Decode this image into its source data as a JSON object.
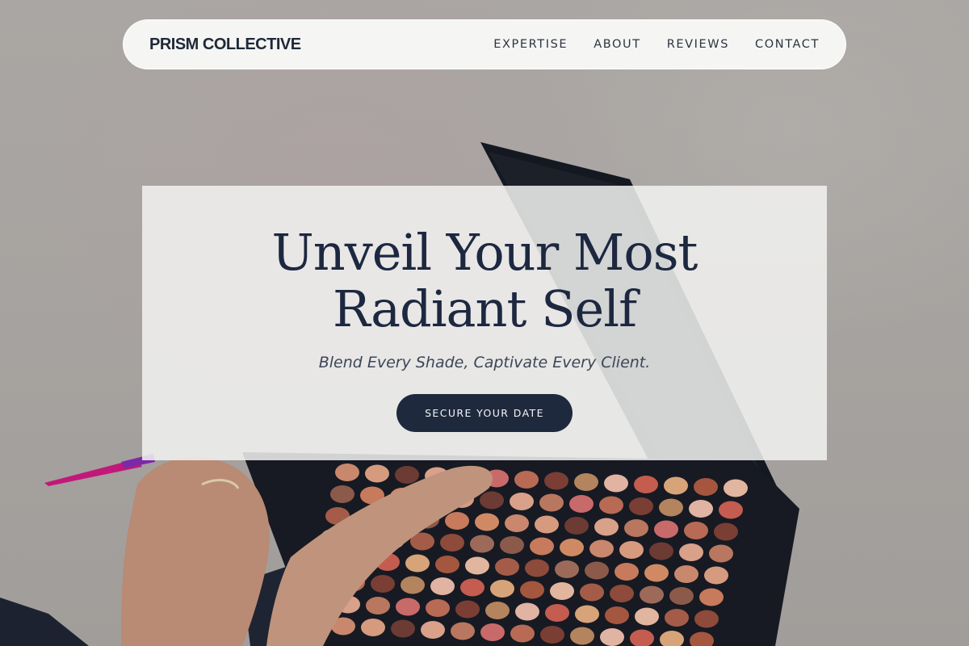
{
  "nav": {
    "brand": "PRISM COLLECTIVE",
    "links": [
      {
        "label": "EXPERTISE"
      },
      {
        "label": "ABOUT"
      },
      {
        "label": "REVIEWS"
      },
      {
        "label": "CONTACT"
      }
    ]
  },
  "hero": {
    "title_line1": "Unveil Your Most",
    "title_line2": "Radiant Self",
    "subtitle": "Blend Every Shade, Captivate Every Client.",
    "cta_label": "SECURE YOUR DATE"
  },
  "background": {
    "description_icon": "makeup-palette-photo",
    "colors": {
      "wall": "#a8a5a3",
      "palette_case": "#12151c",
      "brush_handle": "#c2187a",
      "sleeve": "#1b2230"
    }
  },
  "colors": {
    "brand_text": "#1f2937",
    "title_text": "#1d2840",
    "cta_bg": "#1e293d",
    "cta_text": "#f5f6f8"
  }
}
